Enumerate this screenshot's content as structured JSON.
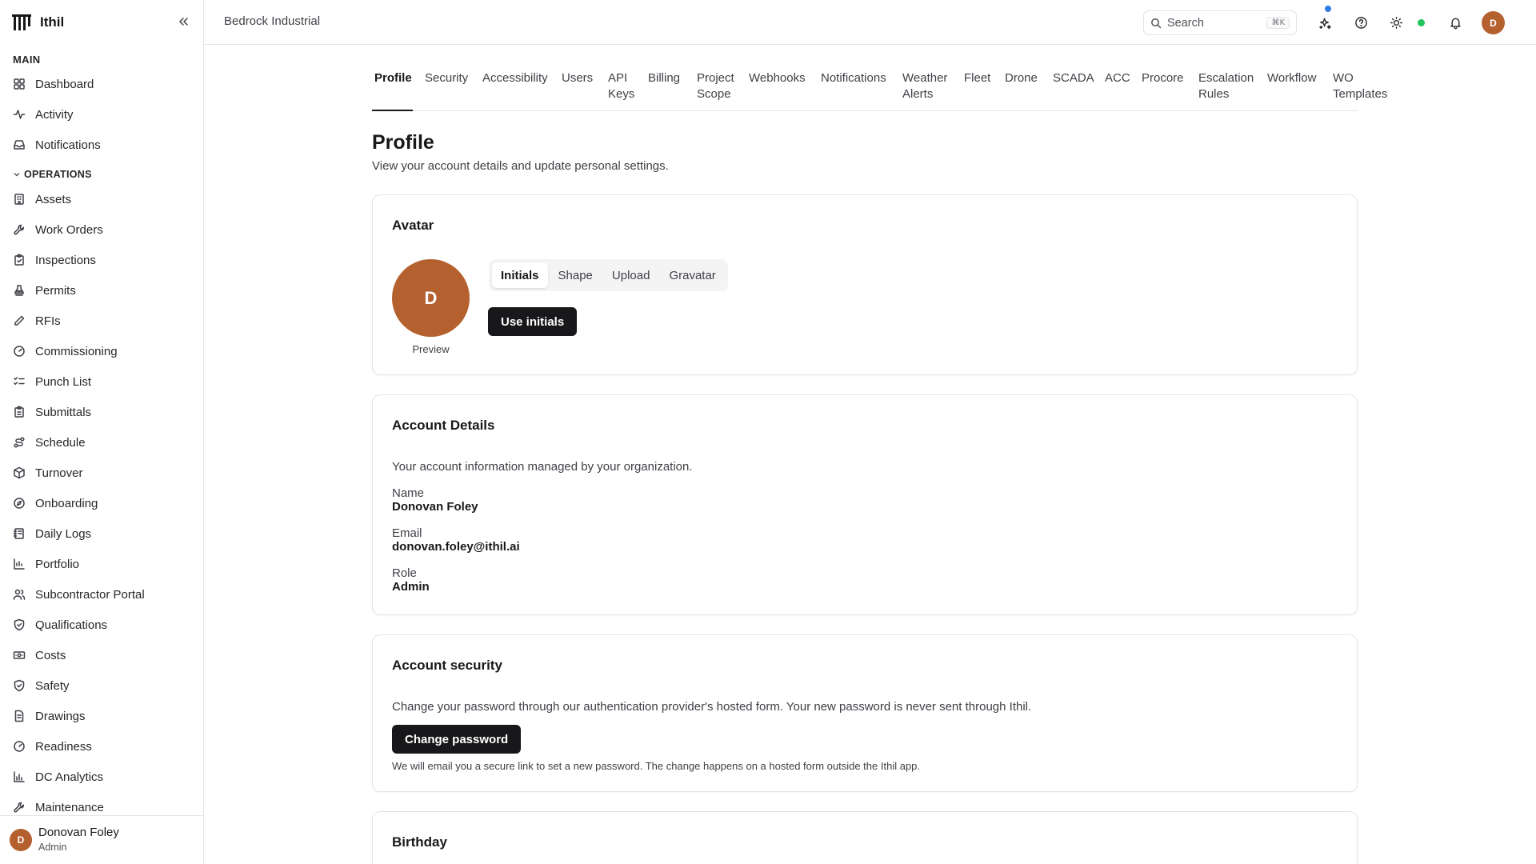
{
  "app": {
    "name": "Ithil",
    "workspace": "Bedrock Industrial"
  },
  "sidebar": {
    "main_label": "MAIN",
    "main_items": [
      {
        "label": "Dashboard",
        "icon": "grid-icon"
      },
      {
        "label": "Activity",
        "icon": "activity-icon"
      },
      {
        "label": "Notifications",
        "icon": "inbox-icon"
      }
    ],
    "ops_label": "OPERATIONS",
    "ops_items": [
      {
        "label": "Assets",
        "icon": "building-icon"
      },
      {
        "label": "Work Orders",
        "icon": "wrench-icon"
      },
      {
        "label": "Inspections",
        "icon": "clipboard-check-icon"
      },
      {
        "label": "Permits",
        "icon": "stamp-icon"
      },
      {
        "label": "RFIs",
        "icon": "pencil-icon"
      },
      {
        "label": "Commissioning",
        "icon": "gauge-icon"
      },
      {
        "label": "Punch List",
        "icon": "list-checks-icon"
      },
      {
        "label": "Submittals",
        "icon": "clipboard-icon"
      },
      {
        "label": "Schedule",
        "icon": "route-icon"
      },
      {
        "label": "Turnover",
        "icon": "package-icon"
      },
      {
        "label": "Onboarding",
        "icon": "compass-icon"
      },
      {
        "label": "Daily Logs",
        "icon": "notebook-icon"
      },
      {
        "label": "Portfolio",
        "icon": "chart-icon"
      },
      {
        "label": "Subcontractor Portal",
        "icon": "users-icon"
      },
      {
        "label": "Qualifications",
        "icon": "shield-check-icon"
      },
      {
        "label": "Costs",
        "icon": "banknote-icon"
      },
      {
        "label": "Safety",
        "icon": "shield-icon"
      },
      {
        "label": "Drawings",
        "icon": "file-icon"
      },
      {
        "label": "Readiness",
        "icon": "gauge-icon"
      },
      {
        "label": "DC Analytics",
        "icon": "bar-chart-icon"
      },
      {
        "label": "Maintenance",
        "icon": "wrench-icon"
      }
    ],
    "user": {
      "initial": "D",
      "name": "Donovan Foley",
      "role": "Admin"
    }
  },
  "header": {
    "search_placeholder": "Search",
    "search_shortcut": "⌘K",
    "avatar_initial": "D"
  },
  "tabs": [
    {
      "label": "Profile",
      "active": true
    },
    {
      "label": "Security"
    },
    {
      "label": "Accessibility"
    },
    {
      "label": "Users"
    },
    {
      "label": "API Keys"
    },
    {
      "label": "Billing"
    },
    {
      "label": "Project Scope"
    },
    {
      "label": "Webhooks"
    },
    {
      "label": "Notifications"
    },
    {
      "label": "Weather Alerts"
    },
    {
      "label": "Fleet"
    },
    {
      "label": "Drone"
    },
    {
      "label": "SCADA"
    },
    {
      "label": "ACC"
    },
    {
      "label": "Procore"
    },
    {
      "label": "Escalation Rules"
    },
    {
      "label": "Workflow"
    },
    {
      "label": "WO Templates"
    }
  ],
  "page": {
    "title": "Profile",
    "subtitle": "View your account details and update personal settings."
  },
  "avatar_card": {
    "title": "Avatar",
    "initial": "D",
    "preview_label": "Preview",
    "options": [
      "Initials",
      "Shape",
      "Upload",
      "Gravatar"
    ],
    "selected": "Initials",
    "button": "Use initials",
    "color": "#b5602f"
  },
  "account_card": {
    "title": "Account Details",
    "description": "Your account information managed by your organization.",
    "name_label": "Name",
    "name_value": "Donovan Foley",
    "email_label": "Email",
    "email_value": "donovan.foley@ithil.ai",
    "role_label": "Role",
    "role_value": "Admin"
  },
  "security_card": {
    "title": "Account security",
    "description": "Change your password through our authentication provider's hosted form. Your new password is never sent through Ithil.",
    "button": "Change password",
    "note": "We will email you a secure link to set a new password. The change happens on a hosted form outside the Ithil app."
  },
  "birthday_card": {
    "title": "Birthday"
  },
  "colors": {
    "accent_dark": "#18181b",
    "avatar": "#b5602f",
    "status_online": "#22c55e",
    "notification_dot": "#2f7ce0"
  }
}
